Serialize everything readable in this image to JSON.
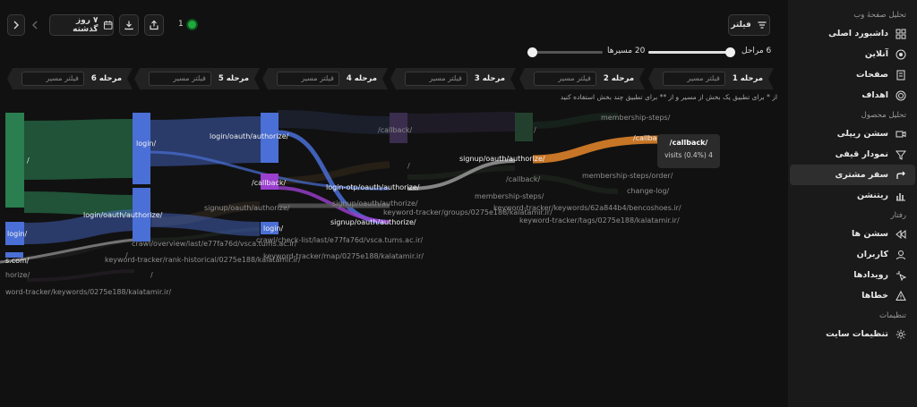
{
  "colors": {
    "accent_green": "#1faa3e",
    "sankey_blue": "#4a6fd6",
    "sankey_green": "#2e8b57",
    "sankey_purple": "#9b3fd0",
    "sankey_orange": "#e8872a"
  },
  "sidebar": {
    "sections": [
      {
        "title": "تحلیل صفحهٔ وب",
        "items": [
          {
            "label": "داشبورد اصلی",
            "icon": "dashboard-icon",
            "active": false
          },
          {
            "label": "آنلاین",
            "icon": "online-icon",
            "active": false
          },
          {
            "label": "صفحات",
            "icon": "pages-icon",
            "active": false
          },
          {
            "label": "اهداف",
            "icon": "target-icon",
            "active": false
          }
        ]
      },
      {
        "title": "تحلیل محصول",
        "items": [
          {
            "label": "سشن ریپلی",
            "icon": "video-icon",
            "active": false
          },
          {
            "label": "نمودار قیفی",
            "icon": "funnel-icon",
            "active": false
          },
          {
            "label": "سفر مشتری",
            "icon": "journey-icon",
            "active": true
          },
          {
            "label": "ریتنشن",
            "icon": "chart-icon",
            "active": false
          }
        ]
      },
      {
        "title": "رفتار",
        "items": [
          {
            "label": "سشن ها",
            "icon": "sessions-icon",
            "active": false
          },
          {
            "label": "کاربران",
            "icon": "user-icon",
            "active": false
          },
          {
            "label": "رویدادها",
            "icon": "events-icon",
            "active": false
          },
          {
            "label": "خطاها",
            "icon": "warning-icon",
            "active": false
          }
        ]
      },
      {
        "title": "تنظیمات",
        "items": [
          {
            "label": "تنظیمات سایت",
            "icon": "gear-icon",
            "active": false
          }
        ]
      }
    ]
  },
  "toolbar": {
    "filter_label": "فیلتر",
    "date_range_label": "۷ روز گذشته",
    "live_count": "1"
  },
  "controls": {
    "steps_label": "6 مراحل",
    "steps_value": 6,
    "steps_fraction": 0.98,
    "paths_label": "20 مسیرها",
    "paths_value": 20,
    "paths_fraction": 0.02
  },
  "stages": [
    {
      "label": "مرحله 1",
      "placeholder": "فیلتر مسیر"
    },
    {
      "label": "مرحله 2",
      "placeholder": "فیلتر مسیر"
    },
    {
      "label": "مرحله 3",
      "placeholder": "فیلتر مسیر"
    },
    {
      "label": "مرحله 4",
      "placeholder": "فیلتر مسیر"
    },
    {
      "label": "مرحله 5",
      "placeholder": "فیلتر مسیر"
    },
    {
      "label": "مرحله 6",
      "placeholder": "فیلتر مسیر"
    }
  ],
  "hint": "از * برای تطبیق یک بخش از مسیر و از ** برای تطبیق چند بخش استفاده کنید",
  "sankey": {
    "labels": {
      "root": "/",
      "login_1": "login/",
      "login_2": "login/",
      "login_oauth_1": "login/oauth/authorize/",
      "login_oauth_2": "login/oauth/authorize/",
      "callback_1": "/callback/",
      "callback_2": "/callback/",
      "callback_3": "/callback/",
      "callback_dim": "/callback/",
      "login_otp": "login-otp/oauth/authorize/",
      "signup_oauth_1": "signup/oauth/authorize/",
      "signup_oauth_2": "signup/oauth/authorize/",
      "signup_oauth_3": "signup/oauth/authorize/",
      "membership_steps_1": "membership-steps/",
      "membership_steps_2": "membership-steps/",
      "membership_order": "membership-steps/order/",
      "change_log": "change-log/",
      "keyword_tracker_groups": "keyword-tracker/groups/0275e188/kalatamir.ir/",
      "keyword_tracker_keywords": "keyword-tracker/keywords/62a844b4/bencoshoes.ir/",
      "keyword_tracker_tags": "keyword-tracker/tags/0275e188/kalatamir.ir/",
      "keyword_tracker_map": "keyword-tracker/map/0275e188/kalatamir.ir/",
      "crawl_overview": "crawl/overview/last/e77fa76d/vsca.tums.ac.ir/",
      "crawl_checklist": "crawl/check-list/last/e77fa76d/vsca.tums.ac.ir/",
      "rank_historical": "keyword-tracker/rank-historical/0275e188/kalatamir.ir/",
      "tracker_keywords_left": "word-tracker/keywords/0275e188/kalatamir.ir/",
      "horize": "horize/",
      "com": "s.com/",
      "slash_1": "/",
      "slash_2": "/",
      "slash_3": "/"
    }
  },
  "tooltip": {
    "title": "/callback/",
    "text": "visits (0.4%) 4"
  }
}
